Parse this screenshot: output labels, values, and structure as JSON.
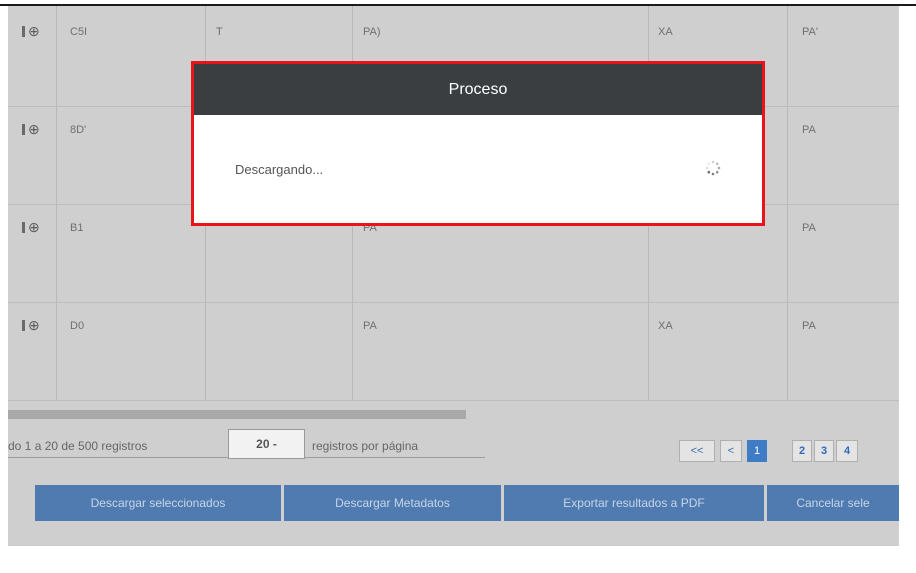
{
  "table": {
    "rows": [
      [
        "C5I",
        "T",
        "PA)",
        "XA",
        "PA'"
      ],
      [
        "8D'",
        "",
        "",
        "",
        "PA"
      ],
      [
        "B1",
        "",
        "PA",
        "",
        "PA"
      ],
      [
        "D0",
        "",
        "PA",
        "XA",
        "PA"
      ]
    ]
  },
  "pagination": {
    "info": "do 1 a 20 de 500 registros",
    "per_page_value": "20 -",
    "per_page_label": "registros por página",
    "first": "<<",
    "prev": "<",
    "pages": [
      "1",
      "2",
      "3",
      "4"
    ],
    "active_page": "1"
  },
  "actions": {
    "download_selected": "Descargar seleccionados",
    "download_metadata": "Descargar Metadatos",
    "export_pdf": "Exportar resultados a PDF",
    "cancel_selection": "Cancelar sele"
  },
  "modal": {
    "title": "Proceso",
    "message": "Descargando..."
  },
  "colors": {
    "modal_border": "#e8131b",
    "modal_header": "#3a3e41",
    "action_button": "#4f7bb0",
    "active_page": "#3f7cc6"
  }
}
